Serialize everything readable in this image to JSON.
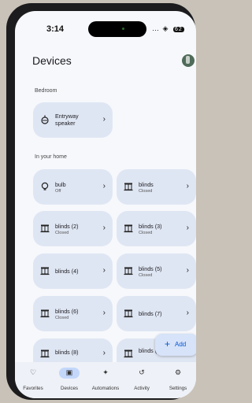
{
  "status": {
    "time": "3:14",
    "battery": "62"
  },
  "title": "Devices",
  "sections": {
    "bedroom": "Bedroom",
    "home": "In your home"
  },
  "devices": [
    {
      "name": "Entryway speaker",
      "line1": "Entryway",
      "line2": "speaker",
      "status": "",
      "icon": "speaker-icon"
    },
    {
      "name": "bulb",
      "status": "Off",
      "icon": "bulb-icon"
    },
    {
      "name": "blinds",
      "status": "Closed",
      "icon": "blinds-icon"
    },
    {
      "name": "blinds (2)",
      "status": "Closed",
      "icon": "blinds-icon"
    },
    {
      "name": "blinds (3)",
      "status": "Closed",
      "icon": "blinds-icon"
    },
    {
      "name": "blinds (4)",
      "status": "",
      "icon": "blinds-icon"
    },
    {
      "name": "blinds (5)",
      "status": "Closed",
      "icon": "blinds-icon"
    },
    {
      "name": "blinds (6)",
      "status": "Closed",
      "icon": "blinds-icon"
    },
    {
      "name": "blinds (7)",
      "status": "",
      "icon": "blinds-icon"
    },
    {
      "name": "blinds (8)",
      "status": "",
      "icon": "blinds-icon"
    },
    {
      "name": "blinds (9)",
      "status": "",
      "icon": "blinds-icon"
    }
  ],
  "fab": {
    "label": "Add"
  },
  "nav": [
    {
      "label": "Favorites",
      "icon": "heart-icon"
    },
    {
      "label": "Devices",
      "icon": "devices-icon",
      "active": true
    },
    {
      "label": "Automations",
      "icon": "sparkle-icon"
    },
    {
      "label": "Activity",
      "icon": "history-icon"
    },
    {
      "label": "Settings",
      "icon": "gear-icon"
    }
  ]
}
